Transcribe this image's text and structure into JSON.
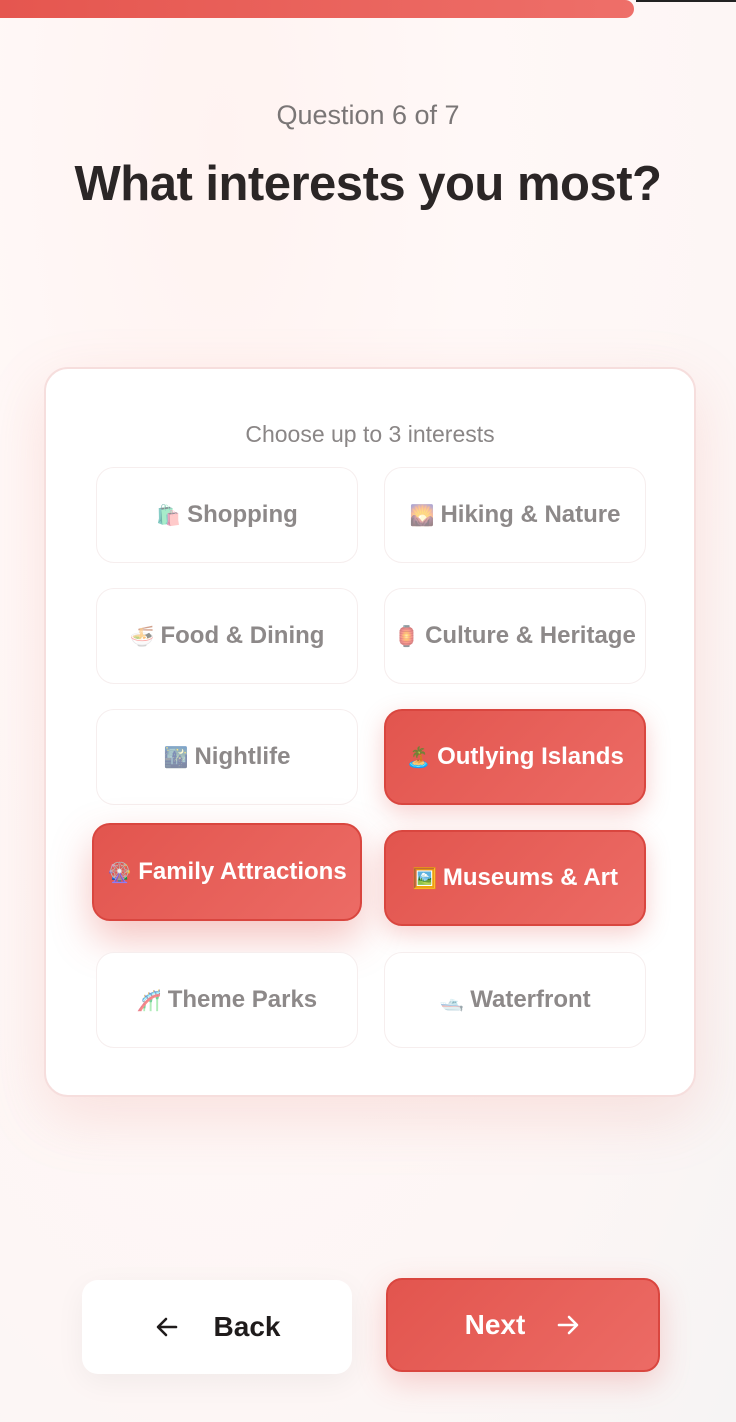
{
  "progress": {
    "fraction": 0.8614
  },
  "header": {
    "question_count": "Question 6 of 7",
    "title": "What interests you most?"
  },
  "card": {
    "hint": "Choose up to 3 interests",
    "options": [
      {
        "emoji": "🛍️",
        "label": "Shopping",
        "selected": false
      },
      {
        "emoji": "🌄",
        "label": "Hiking & Nature",
        "selected": false
      },
      {
        "emoji": "🍜",
        "label": "Food & Dining",
        "selected": false
      },
      {
        "emoji": "🏮",
        "label": "Culture & Heritage",
        "selected": false
      },
      {
        "emoji": "🌃",
        "label": "Nightlife",
        "selected": false
      },
      {
        "emoji": "🏝️",
        "label": "Outlying Islands",
        "selected": true
      },
      {
        "emoji": "🎡",
        "label": "Family Attractions",
        "selected": true
      },
      {
        "emoji": "🖼️",
        "label": "Museums & Art",
        "selected": true
      },
      {
        "emoji": "🎢",
        "label": "Theme Parks",
        "selected": false
      },
      {
        "emoji": "🛥️",
        "label": "Waterfront",
        "selected": false
      }
    ]
  },
  "nav": {
    "back_label": "Back",
    "next_label": "Next",
    "back_icon": "arrow-left-icon",
    "next_icon": "arrow-right-icon"
  },
  "colors": {
    "accent": "#E5564F",
    "accent_light": "#EC6B65"
  }
}
